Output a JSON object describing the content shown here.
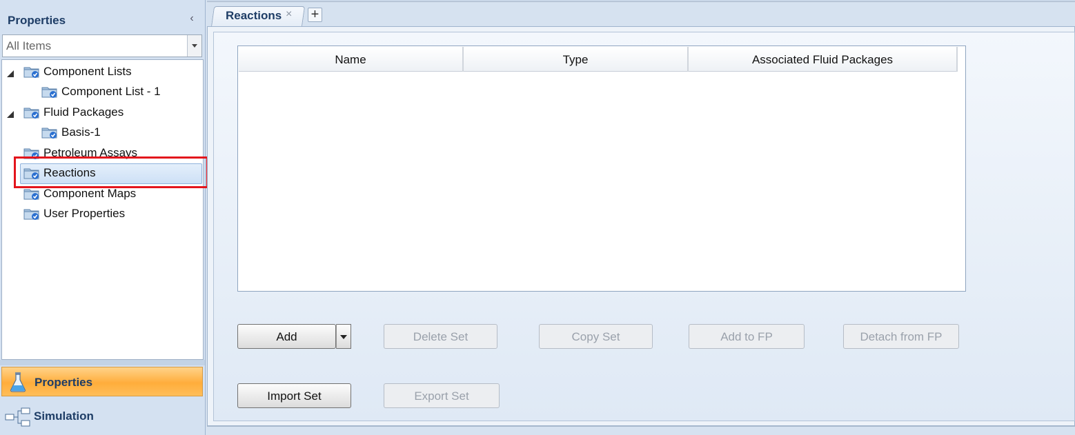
{
  "left_panel": {
    "title": "Properties",
    "filter": {
      "value": "All Items"
    },
    "tree": [
      {
        "label": "Component Lists",
        "expanded": true
      },
      {
        "label": "Component List - 1"
      },
      {
        "label": "Fluid Packages",
        "expanded": true
      },
      {
        "label": "Basis-1"
      },
      {
        "label": "Petroleum Assays"
      },
      {
        "label": "Reactions",
        "selected": true
      },
      {
        "label": "Component Maps"
      },
      {
        "label": "User Properties"
      }
    ],
    "nav": {
      "properties": "Properties",
      "simulation": "Simulation"
    }
  },
  "tabs": [
    {
      "label": "Reactions",
      "close": "×"
    }
  ],
  "tab_add": "+",
  "grid": {
    "columns": [
      "Name",
      "Type",
      "Associated Fluid Packages"
    ],
    "rows": []
  },
  "buttons": {
    "add": "Add",
    "delete_set": "Delete Set",
    "copy_set": "Copy Set",
    "add_to_fp": "Add to FP",
    "detach_from_fp": "Detach from FP",
    "import_set": "Import Set",
    "export_set": "Export Set"
  },
  "colors": {
    "highlight_box": "#e3141c",
    "active_nav": "#ffad3b",
    "title_text": "#1e3d66"
  }
}
